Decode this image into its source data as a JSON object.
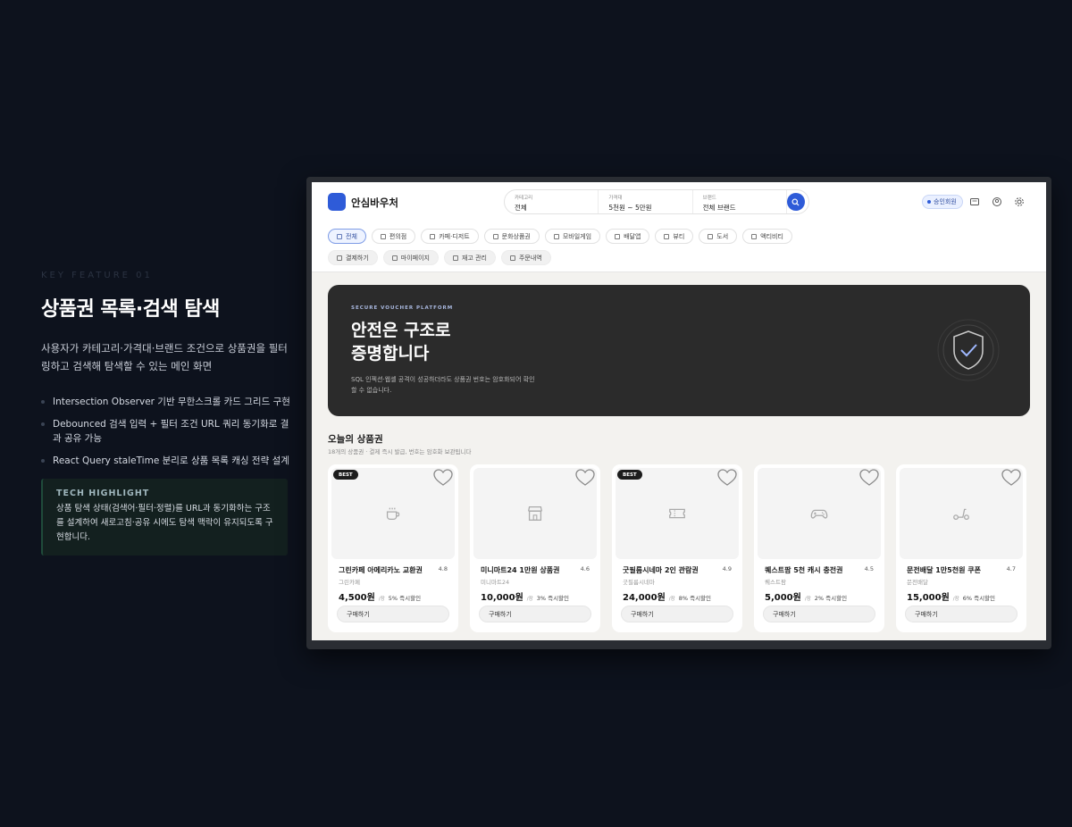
{
  "feature": {
    "kicker": "KEY FEATURE 01",
    "title": "상품권 목록·검색 탐색",
    "description": "사용자가 카테고리·가격대·브랜드 조건으로 상품권을 필터링하고 검색해 탐색할 수 있는 메인 화면",
    "bullets": [
      "Intersection Observer 기반 무한스크롤 카드 그리드 구현",
      "Debounced 검색 입력 + 필터 조건 URL 쿼리 동기화로 결과 공유 가능",
      "React Query staleTime 분리로 상품 목록 캐싱 전략 설계"
    ],
    "tech_label": "TECH HIGHLIGHT",
    "tech_text": "상품 탐색 상태(검색어·필터·정렬)를 URL과 동기화하는 구조를 설계하여 새로고침·공유 시에도 탐색 맥락이 유지되도록 구현합니다."
  },
  "app": {
    "logo": "안심바우처",
    "search": {
      "category_label": "카테고리",
      "category_value": "전체",
      "price_label": "가격대",
      "price_value": "5천원 ~ 5만원",
      "brand_label": "브랜드",
      "brand_value": "전체 브랜드"
    },
    "member_badge": "승인회원",
    "categories": [
      "전체",
      "편의점",
      "카페·디저트",
      "문화상품권",
      "모바일게임",
      "배달앱",
      "뷰티",
      "도서",
      "액티비티"
    ],
    "quick_links": [
      "결제하기",
      "마이페이지",
      "재고 관리",
      "주문내역"
    ],
    "hero": {
      "kicker": "SECURE VOUCHER PLATFORM",
      "title_line1": "안전은 구조로",
      "title_line2": "증명합니다",
      "desc": "SQL 인젝션·웹셸 공격이 성공하더라도 상품권 번호는 암호화되어 확인할 수 없습니다."
    },
    "section": {
      "title": "오늘의 상품권",
      "desc": "18개의 상품권 · 결제 즉시 발급, 번호는 암호화 보관됩니다"
    },
    "buy_label": "구매하기",
    "price_unit": "/장",
    "cards": [
      {
        "best": "BEST",
        "name": "그린카페 아메리카노 교환권",
        "rating": "4.8",
        "brand": "그린카페",
        "price": "4,500원",
        "discount": "5% 즉시할인",
        "icon": "coffee-icon"
      },
      {
        "best": "",
        "name": "미니마트24 1만원 상품권",
        "rating": "4.6",
        "brand": "미니마트24",
        "price": "10,000원",
        "discount": "3% 즉시할인",
        "icon": "store-icon"
      },
      {
        "best": "BEST",
        "name": "굿필름시네마 2인 관람권",
        "rating": "4.9",
        "brand": "굿필름시네마",
        "price": "24,000원",
        "discount": "8% 즉시할인",
        "icon": "ticket-icon"
      },
      {
        "best": "",
        "name": "퀘스트팜 5천 캐시 충전권",
        "rating": "4.5",
        "brand": "퀘스트팜",
        "price": "5,000원",
        "discount": "2% 즉시할인",
        "icon": "gamepad-icon"
      },
      {
        "best": "",
        "name": "문전배달 1만5천원 쿠폰",
        "rating": "4.7",
        "brand": "문전배달",
        "price": "15,000원",
        "discount": "6% 즉시할인",
        "icon": "scooter-icon"
      }
    ],
    "colors": {
      "accent": "#2e5bd8",
      "hero_bg": "#2b2b2b",
      "page_bg": "#0d121d"
    }
  }
}
